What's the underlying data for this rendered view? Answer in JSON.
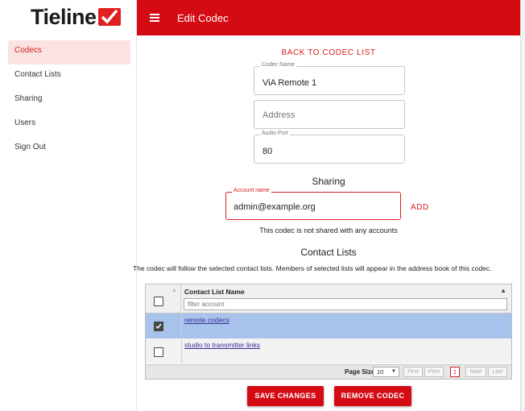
{
  "brand": {
    "name": "Tieline",
    "accent": "#d50b14"
  },
  "sidebar": {
    "items": [
      {
        "label": "Codecs",
        "active": true
      },
      {
        "label": "Contact Lists"
      },
      {
        "label": "Sharing"
      },
      {
        "label": "Users"
      },
      {
        "label": "Sign Out"
      }
    ]
  },
  "topbar": {
    "title": "Edit Codec",
    "menu_icon": "hamburger-icon"
  },
  "main": {
    "back_link": "BACK TO CODEC LIST",
    "codec_name": {
      "label": "Codec Name",
      "value": "ViA Remote 1"
    },
    "address": {
      "placeholder": "Address"
    },
    "audio_port": {
      "label": "Audio Port",
      "value": "80"
    },
    "sharing": {
      "title": "Sharing",
      "account": {
        "label": "Account name",
        "value": "admin@example.org"
      },
      "add_label": "ADD",
      "note": "This codec is not shared with any accounts"
    },
    "contact_lists": {
      "title": "Contact Lists",
      "description": "The codec will follow the selected contact lists. Members of selected lists will appear in the address book of this codec.",
      "column_header": "Contact List Name",
      "filter_placeholder": "filter account",
      "rows": [
        {
          "name": "remote codecs",
          "checked": true
        },
        {
          "name": "studio to transmitter links",
          "checked": false
        }
      ],
      "pager": {
        "page_size_label": "Page Size",
        "page_size": "10",
        "first": "First",
        "prev": "Prev",
        "current": "1",
        "next": "Next",
        "last": "Last"
      }
    },
    "save_label": "SAVE CHANGES",
    "remove_label": "REMOVE CODEC"
  }
}
